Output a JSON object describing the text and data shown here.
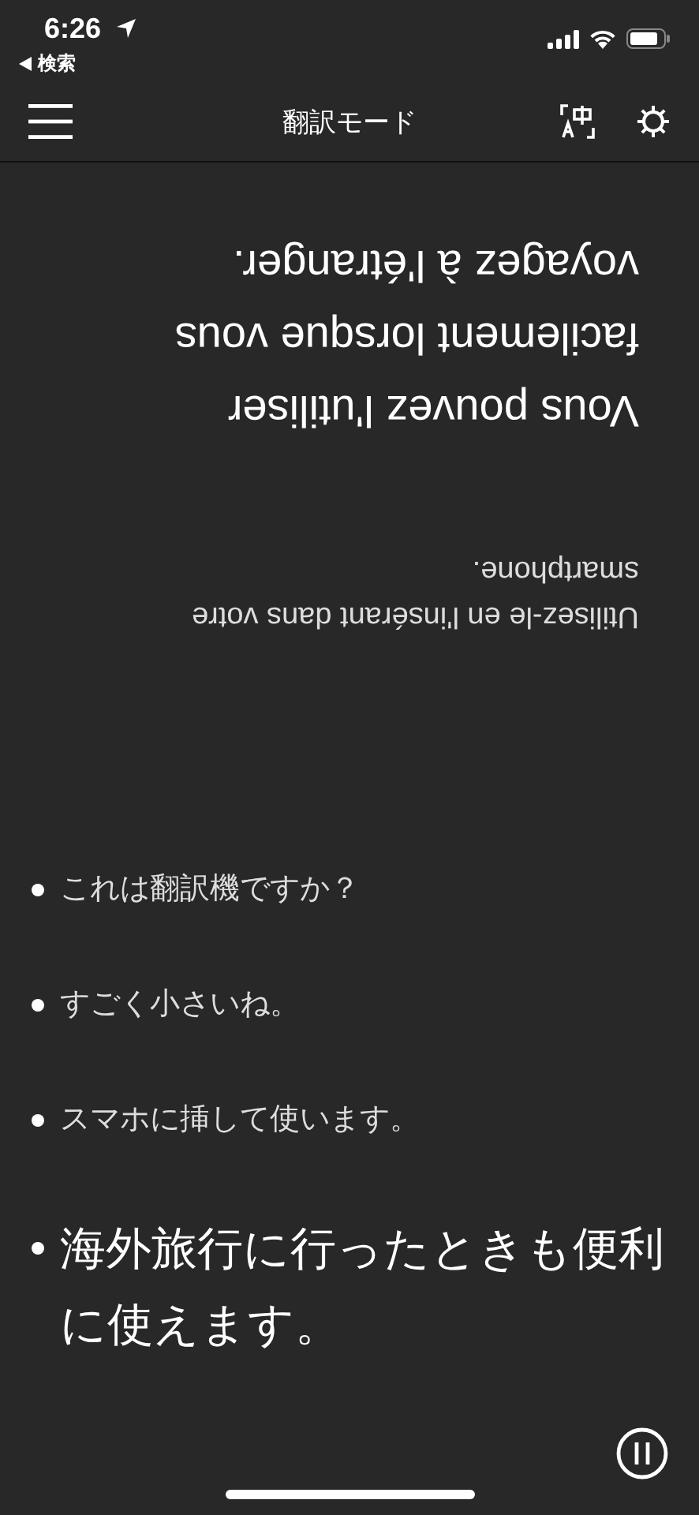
{
  "status_bar": {
    "time": "6:26",
    "back_label": "検索"
  },
  "header": {
    "title": "翻訳モード"
  },
  "translation": {
    "segments": [
      {
        "text": "Utilisez-le en l'insérant dans votre smartphone.",
        "current": false
      },
      {
        "text": "Vous pouvez l'utiliser facilement lorsque vous voyagez à l'étranger.",
        "current": true
      }
    ]
  },
  "transcript": {
    "items": [
      {
        "text": "これは翻訳機ですか？",
        "current": false
      },
      {
        "text": "すごく小さいね。",
        "current": false
      },
      {
        "text": "スマホに挿して使います。",
        "current": false
      },
      {
        "text": "海外旅行に行ったときも便利に使えます。",
        "current": true
      }
    ]
  }
}
